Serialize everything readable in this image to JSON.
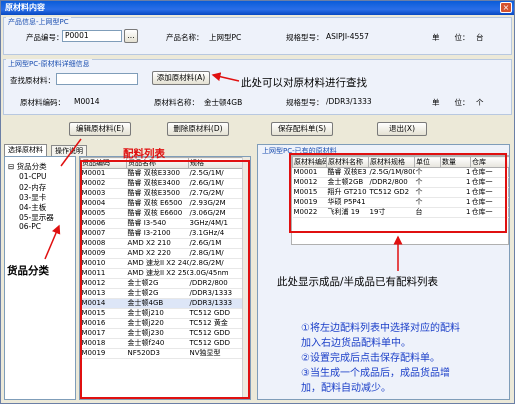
{
  "window": {
    "title": "原材料内容",
    "close": "×"
  },
  "product_info": {
    "section_title": "产品信息-上网型PC",
    "code_label": "产品编号：",
    "code_value": "P0001",
    "browse": "...",
    "name_label": "产品名称：",
    "name_value": "上网型PC",
    "spec_label": "规格型号：",
    "spec_value": "ASIPJI-4557",
    "unit_label": "单　　位：",
    "unit_value": "台"
  },
  "detail": {
    "section_title": "上网型PC-原材料详细信息",
    "search_label": "查找原材料：",
    "search_value": "",
    "add_button": "添加原材料(A)",
    "code_label": "原材料编码：",
    "code_value": "M0014",
    "name_label": "原材料名称：",
    "name_value": "金士顿4GB",
    "spec_label": "规格型号：",
    "spec_value": "/DDR3/1333",
    "unit_label": "单　　位：",
    "unit_value": "个"
  },
  "actions": {
    "edit": "编辑原材料(E)",
    "delete": "删除原材料(D)",
    "save": "保存配料单(S)",
    "exit": "退出(X)"
  },
  "tabs": [
    "选择原材料",
    "操作说明"
  ],
  "tree": {
    "root": "货品分类",
    "items": [
      "01-CPU",
      "02-内存",
      "03-显卡",
      "04-主板",
      "05-显示器",
      "06-PC"
    ]
  },
  "materials": {
    "headers": [
      "货品编码",
      "货品名称",
      "规格"
    ],
    "rows": [
      [
        "M0001",
        "酷睿 双核E3300",
        "/2.5G/1M/"
      ],
      [
        "M0002",
        "酷睿 双核E3400",
        "/2.6G/1M/"
      ],
      [
        "M0003",
        "酷睿 双核E3500",
        "/2.7G/2M/"
      ],
      [
        "M0004",
        "酷睿 双核 E6500",
        "/2.93G/2M"
      ],
      [
        "M0005",
        "酷睿 双核 E6600",
        "/3.06G/2M"
      ],
      [
        "M0006",
        "酷睿 I3-540",
        "3GHz/4M/1"
      ],
      [
        "M0007",
        "酷睿 I3-2100",
        "/3.1GHz/4"
      ],
      [
        "M0008",
        "AMD X2 210",
        "/2.6G/1M"
      ],
      [
        "M0009",
        "AMD X2 220",
        "/2.8G/1M/"
      ],
      [
        "M0010",
        "AMD 速龙II X2 240",
        "/2.8G/2M/"
      ],
      [
        "M0011",
        "AMD 速龙II X2 250",
        "3.0G/45nm"
      ],
      [
        "M0012",
        "金士顿2G",
        "/DDR2/800"
      ],
      [
        "M0013",
        "金士顿2G",
        "/DDR3/1333"
      ],
      [
        "M0014",
        "金士顿4GB",
        "/DDR3/1333"
      ],
      [
        "M0015",
        "金士顿j210",
        "TC512 GDD"
      ],
      [
        "M0016",
        "金士顿j220",
        "TC512 黄金"
      ],
      [
        "M0017",
        "金士顿j230",
        "TC512 GDD"
      ],
      [
        "M0018",
        "金士顿f240",
        "TC512 GDD"
      ],
      [
        "M0019",
        "NF520D3",
        "NV独显型"
      ]
    ]
  },
  "bom": {
    "title": "上网型PC-已有的原材料",
    "headers": [
      "原材料编码",
      "原材料名称",
      "原材料规格",
      "单位",
      "数量",
      "仓库"
    ],
    "rows": [
      [
        "M0001",
        "酷睿 双核E3",
        "/2.5G/1M/800",
        "个",
        "1",
        "仓库一"
      ],
      [
        "M0012",
        "金士顿2GB",
        "/DDR2/800",
        "个",
        "1",
        "仓库一"
      ],
      [
        "M0015",
        "翔升 GT210",
        "TC512 GD2",
        "个",
        "1",
        "仓库一"
      ],
      [
        "M0019",
        "华硕 P5P41",
        "",
        "个",
        "1",
        "仓库一"
      ],
      [
        "M0022",
        "飞利浦 19",
        "19寸",
        "台",
        "1",
        "仓库一"
      ]
    ]
  },
  "annotations": {
    "search_hint": "此处可以对原材料进行查找",
    "material_list": "配料列表",
    "category": "货品分类",
    "bom_hint": "此处显示成品/半成品已有配料列表",
    "steps": [
      "①将左边配料列表中选择对应的配料",
      "加入右边货品配料单中。",
      "②设置完成后点击保存配料单。",
      "③当生成一个成品后，成品货品增",
      "加，配料自动减少。"
    ]
  }
}
